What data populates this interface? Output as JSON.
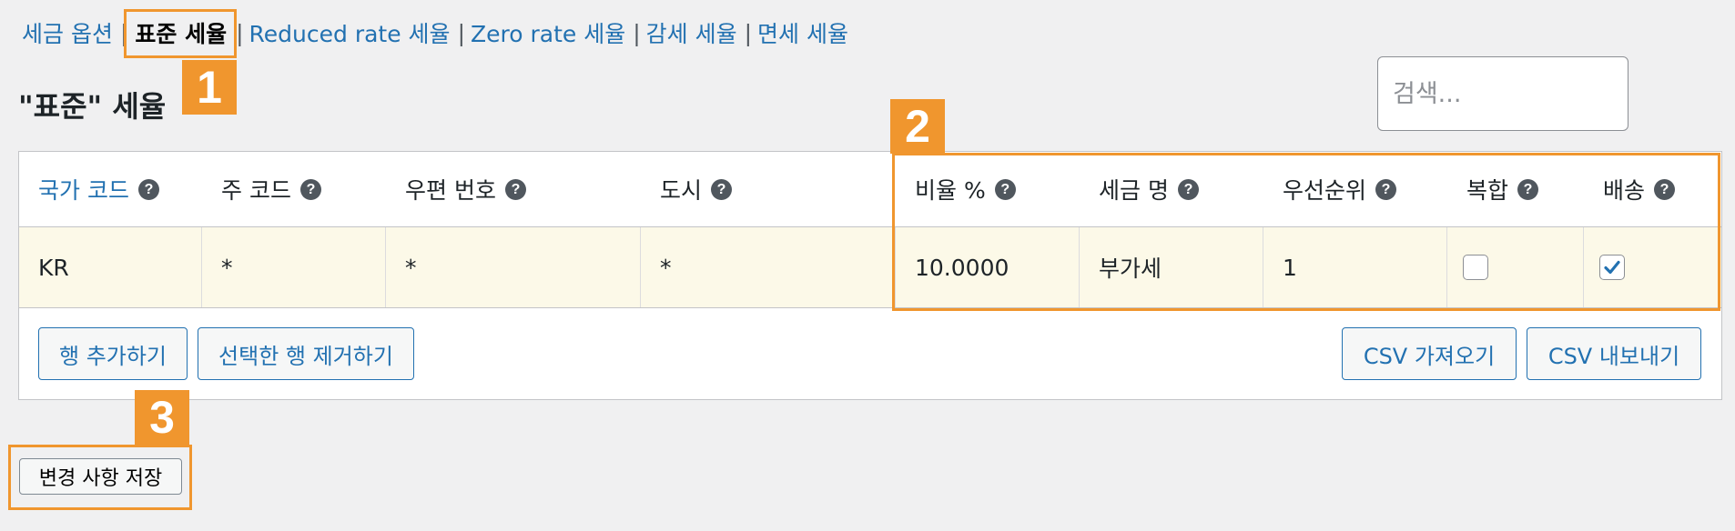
{
  "subnav": {
    "items": [
      {
        "label": "세금 옵션"
      },
      {
        "label": "표준 세율"
      },
      {
        "label": "Reduced rate 세율"
      },
      {
        "label": "Zero rate 세율"
      },
      {
        "label": "감세 세율"
      },
      {
        "label": "면세 세율"
      }
    ],
    "separator": "|",
    "active_index": 1
  },
  "page_title": "\"표준\" 세율",
  "search": {
    "placeholder": "검색..."
  },
  "table": {
    "columns": [
      {
        "label": "국가 코드",
        "help": "?"
      },
      {
        "label": "주 코드",
        "help": "?"
      },
      {
        "label": "우편 번호",
        "help": "?"
      },
      {
        "label": "도시",
        "help": "?"
      },
      {
        "label": "비율 %",
        "help": "?"
      },
      {
        "label": "세금 명",
        "help": "?"
      },
      {
        "label": "우선순위",
        "help": "?"
      },
      {
        "label": "복합",
        "help": "?"
      },
      {
        "label": "배송",
        "help": "?"
      }
    ],
    "rows": [
      {
        "country": "KR",
        "state": "*",
        "postcode": "*",
        "city": "*",
        "rate": "10.0000",
        "name": "부가세",
        "priority": "1",
        "compound": false,
        "shipping": true
      }
    ]
  },
  "actions": {
    "add_row": "행 추가하기",
    "remove_rows": "선택한 행 제거하기",
    "import_csv": "CSV 가져오기",
    "export_csv": "CSV 내보내기",
    "save": "변경 사항 저장"
  },
  "annotations": {
    "badge_1": "1",
    "badge_2": "2",
    "badge_3": "3",
    "color": "#f0962e"
  },
  "colors": {
    "link": "#2271b1",
    "row_highlight": "#fcf9e8",
    "background": "#f0f0f1"
  }
}
